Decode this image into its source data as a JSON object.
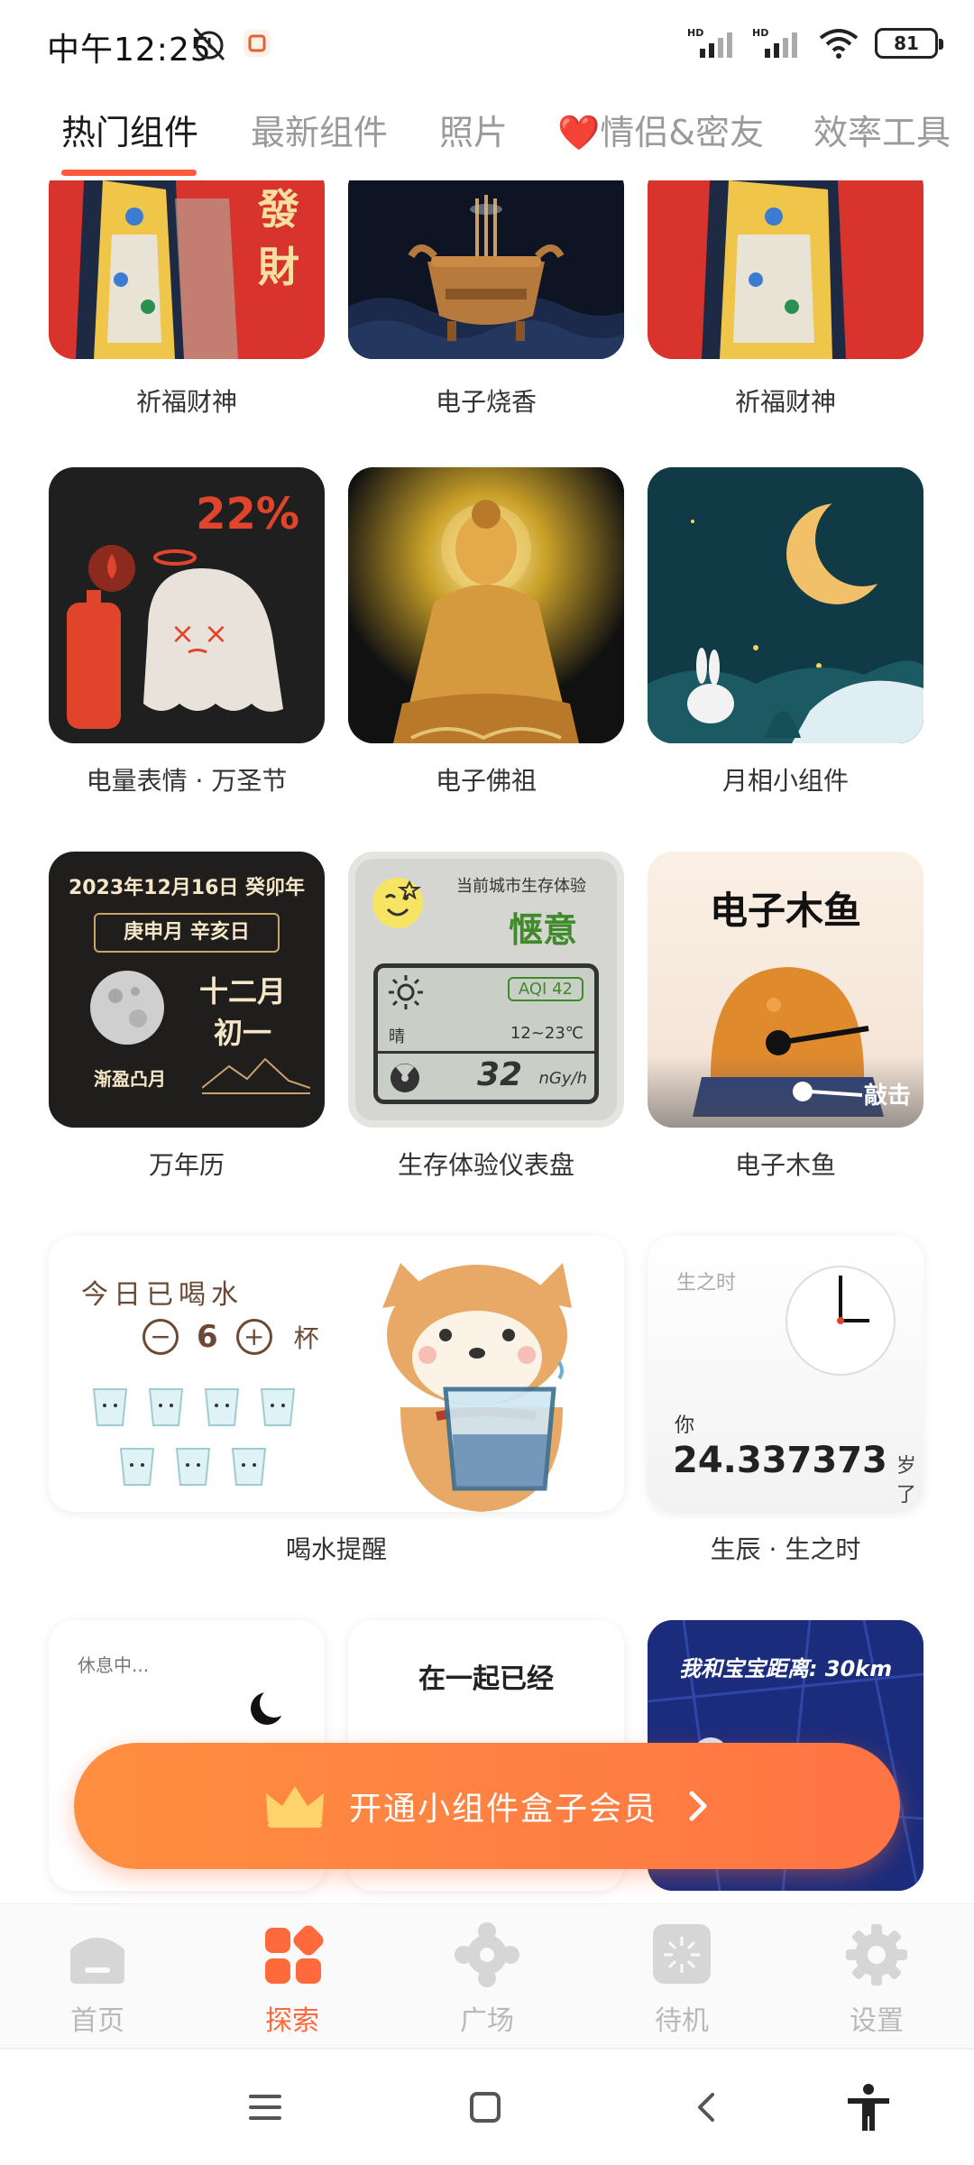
{
  "status": {
    "time": "中午12:25",
    "battery": "81",
    "hd1": "HD",
    "hd2": "HD"
  },
  "tabs": [
    {
      "label": "热门组件"
    },
    {
      "label": "最新组件"
    },
    {
      "label": "照片"
    },
    {
      "label": "❤️情侣&密友"
    },
    {
      "label": "效率工具"
    }
  ],
  "grid": {
    "row1": [
      "祈福财神",
      "电子烧香",
      "祈福财神"
    ],
    "row2": [
      "电量表情 · 万圣节",
      "电子佛祖",
      "月相小组件"
    ],
    "row3": [
      "万年历",
      "生存体验仪表盘",
      "电子木鱼"
    ],
    "row4": [
      "喝水提醒",
      "生辰 · 生之时"
    ]
  },
  "widgets": {
    "fortune_text": "發財",
    "battery_percent": "22%",
    "calendar": {
      "date": "2023年12月16日 癸卯年",
      "ganzhi": "庚申月 辛亥日",
      "lunar_month": "十二月",
      "lunar_day": "初一",
      "moon_phase": "渐盈凸月"
    },
    "survival": {
      "title": "当前城市生存体验",
      "mood": "惬意",
      "aqi": "AQI 42",
      "weather": "晴",
      "temp": "12~23℃",
      "radiation": "32",
      "radiation_unit": "nGy/h"
    },
    "muyu": {
      "title": "电子木鱼",
      "action": "敲击"
    },
    "water": {
      "title": "今日已喝水",
      "count": "6",
      "unit": "杯",
      "minus": "−",
      "plus": "+"
    },
    "birth": {
      "title": "生之时",
      "you": "你",
      "age": "24.337373",
      "suffix": "岁了"
    },
    "rest": {
      "status": "休息中..."
    },
    "together": {
      "title": "在一起已经"
    },
    "distance": {
      "title": "我和宝宝距离: 30km"
    }
  },
  "vip_banner": {
    "label": "开通小组件盒子会员"
  },
  "bottom_nav": [
    {
      "label": "首页"
    },
    {
      "label": "探索"
    },
    {
      "label": "广场"
    },
    {
      "label": "待机"
    },
    {
      "label": "设置"
    }
  ],
  "colors": {
    "accent": "#ff6a3d",
    "tab_active": "#1a1a1a",
    "tab_inactive": "#9a9a9a"
  }
}
